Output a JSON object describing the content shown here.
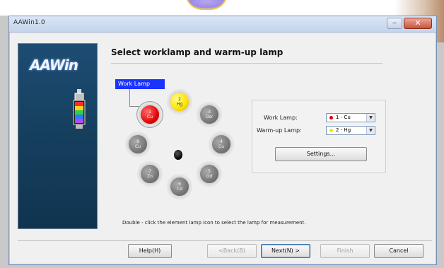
{
  "window": {
    "title": "AAWin1.0"
  },
  "banner": {
    "logo": "AAWin"
  },
  "page": {
    "heading": "Select worklamp and warm-up lamp"
  },
  "lamp_panel": {
    "tag_label": "Work Lamp",
    "lamps": [
      {
        "number": "2",
        "element": "Hg",
        "color": "yellow"
      },
      {
        "number": "3",
        "element": "Dsr",
        "color": "gray"
      },
      {
        "number": "4",
        "element": "Cu",
        "color": "gray"
      },
      {
        "number": "5",
        "element": "Gd",
        "color": "gray"
      },
      {
        "number": "6",
        "element": "Cd",
        "color": "gray"
      },
      {
        "number": "7",
        "element": "Zn",
        "color": "gray"
      },
      {
        "number": "8",
        "element": "Cu",
        "color": "gray"
      },
      {
        "number": "1",
        "element": "Cu",
        "color": "red"
      }
    ]
  },
  "settings": {
    "work_lamp_label": "Work Lamp:",
    "work_lamp_value": "1 - Cu",
    "work_lamp_color": "#e00000",
    "warmup_lamp_label": "Warm-up Lamp:",
    "warmup_lamp_value": "2 - Hg",
    "warmup_lamp_color": "#ffe100",
    "settings_button": "Settings..."
  },
  "instruction": "Double - click the element lamp icon to select the lamp for measurement.",
  "footer": {
    "help": "Help(H)",
    "back": "<Back(B)",
    "next": "Next(N) >",
    "finish": "Finish",
    "cancel": "Cancel"
  }
}
